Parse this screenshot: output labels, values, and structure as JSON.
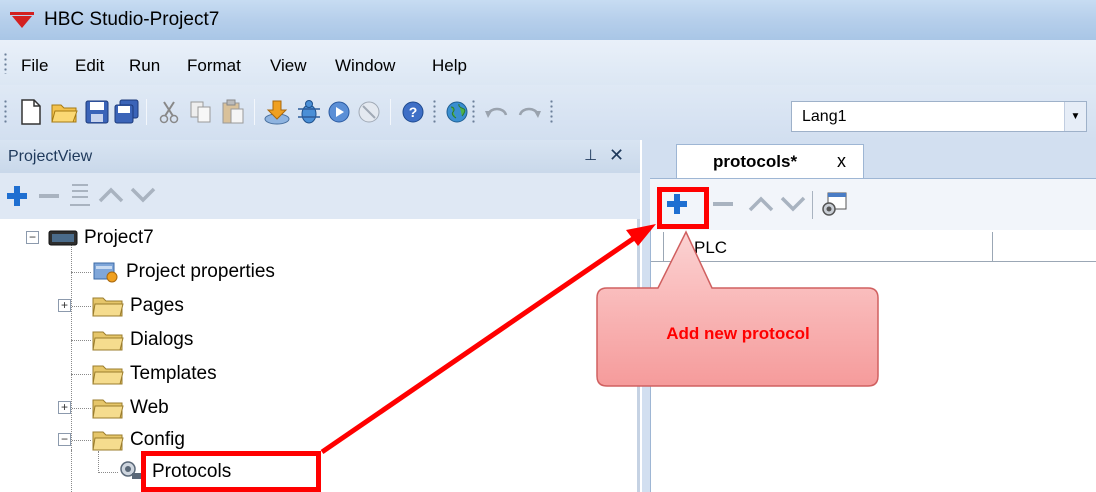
{
  "window": {
    "title": "HBC Studio-Project7"
  },
  "menu": {
    "items": [
      "File",
      "Edit",
      "Run",
      "Format",
      "View",
      "Window",
      "Help"
    ]
  },
  "toolbar": {
    "icons": [
      "new-file-icon",
      "open-folder-icon",
      "save-icon",
      "save-all-icon",
      "cut-icon",
      "copy-icon",
      "paste-icon",
      "download-icon",
      "debug-icon",
      "run-icon",
      "stop-icon",
      "help-icon",
      "globe-icon",
      "undo-icon",
      "redo-icon"
    ],
    "language_value": "Lang1"
  },
  "project_view": {
    "title": "ProjectView",
    "pin_glyph": "⊥",
    "close_glyph": "✕",
    "tree": {
      "root": "Project7",
      "items": [
        "Project properties",
        "Pages",
        "Dialogs",
        "Templates",
        "Web",
        "Config"
      ],
      "config_child": "Protocols"
    }
  },
  "document": {
    "tab_label": "protocols*",
    "tab_close": "x",
    "grid_column": "PLC"
  },
  "annotation": {
    "callout_text": "Add new protocol",
    "color": "#ff0000"
  }
}
